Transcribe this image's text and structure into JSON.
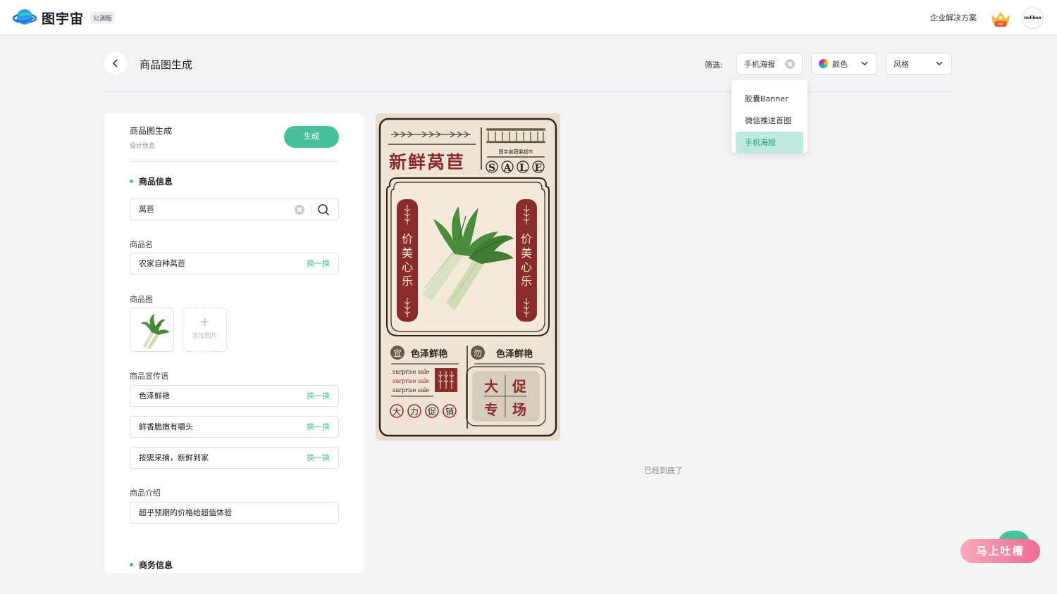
{
  "header": {
    "brand": "图宇宙",
    "beta_badge": "公测版",
    "enterprise_link": "企业解决方案",
    "vip_label": "VIP",
    "avatar_text": "nolibox"
  },
  "page": {
    "title": "商品图生成",
    "filter_label": "筛选:",
    "filters": {
      "type_value": "手机海报",
      "color_label": "颜色",
      "style_label": "风格"
    },
    "dropdown": [
      {
        "label": "胶囊Banner",
        "active": false
      },
      {
        "label": "微信推送首图",
        "active": false
      },
      {
        "label": "手机海报",
        "active": true
      }
    ],
    "end_text": "已经到底了"
  },
  "panel": {
    "title": "商品图生成",
    "subtitle": "设计信息",
    "generate_label": "生成",
    "product_section": "商品信息",
    "search_value": "莴苣",
    "name_label": "商品名",
    "name_value": "农家自种莴苣",
    "swap_label": "换一换",
    "image_label": "商品图",
    "add_image_label": "添加图片",
    "slogan_label": "商品宣传语",
    "slogans": [
      "色泽鲜艳",
      "鲜香脆嫩有嚼头",
      "按需采摘，新鲜到家"
    ],
    "intro_label": "商品介绍",
    "intro_value": "超乎预期的价格给超值体验",
    "business_section": "商务信息"
  },
  "poster": {
    "title": "新鲜莴苣",
    "store": "图宇宙蔬果超市",
    "sale_letters": [
      "S",
      "A",
      "L",
      "E"
    ],
    "side_text": [
      "价",
      "美",
      "心",
      "乐"
    ],
    "badge_left": "宜",
    "badge_right": "勿",
    "tag_left": "色泽鲜艳",
    "tag_right": "色泽鲜艳",
    "surprise": "surprise sale",
    "promo_circles": [
      "大",
      "力",
      "促",
      "销"
    ],
    "promo_box": [
      "大",
      "促",
      "专",
      "场"
    ]
  },
  "feedback": {
    "label": "马上吐槽"
  },
  "colors": {
    "accent": "#45c29b",
    "poster_red": "#8b2c2c",
    "poster_bg": "#efe4d3"
  }
}
